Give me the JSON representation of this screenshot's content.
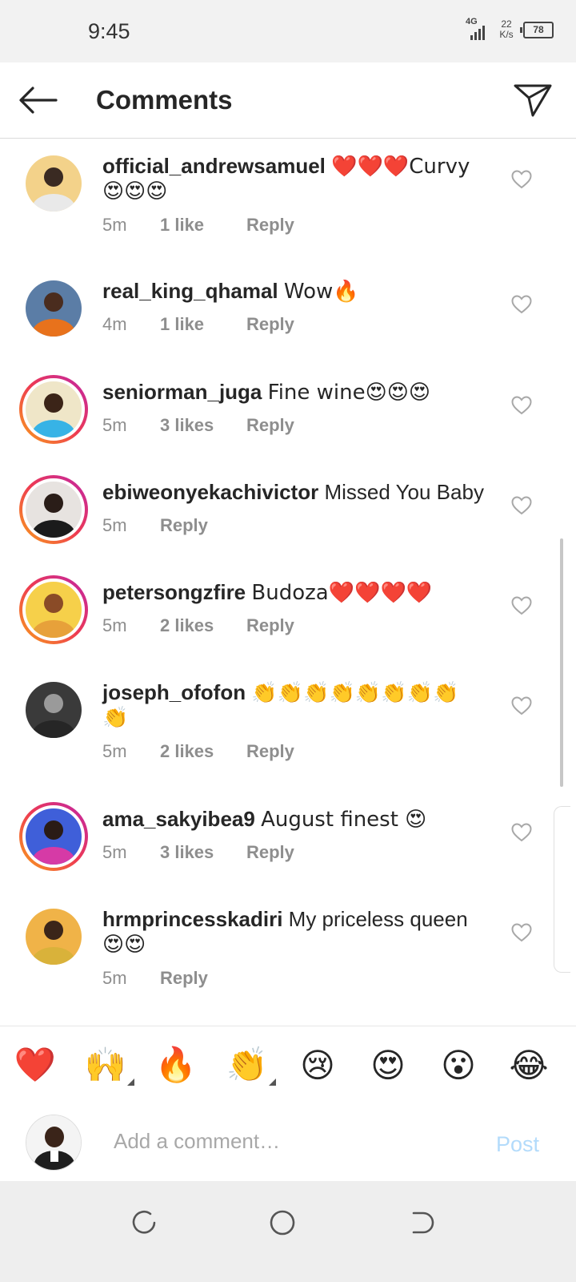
{
  "status_bar": {
    "time": "9:45",
    "network": "4G",
    "speed_value": "22",
    "speed_unit": "K/s",
    "battery": "78"
  },
  "header": {
    "title": "Comments",
    "back_icon": "arrow-left-icon",
    "share_icon": "paper-plane-icon"
  },
  "comments": [
    {
      "username": "official_andrewsamuel",
      "text_line1": "❤️❤️❤️Curvy",
      "text_line2": "😍😍😍",
      "time": "5m",
      "likes": "1 like",
      "reply": "Reply",
      "story_ring": false,
      "avatar_colors": [
        "#f3d28a",
        "#3a2a22",
        "#e9e9e9"
      ]
    },
    {
      "username": "real_king_qhamal",
      "text_line1": "Wow🔥",
      "time": "4m",
      "likes": "1 like",
      "reply": "Reply",
      "story_ring": false,
      "avatar_colors": [
        "#5b7da6",
        "#4a2c1e",
        "#e8721c"
      ]
    },
    {
      "username": "seniorman_juga",
      "text_line1": "Fine wine😍😍😍",
      "time": "5m",
      "likes": "3 likes",
      "reply": "Reply",
      "story_ring": true,
      "avatar_colors": [
        "#efe6c8",
        "#3b2418",
        "#37b3e6"
      ]
    },
    {
      "username": "ebiweonyekachivictor",
      "text_line1": "Missed You Baby",
      "time": "5m",
      "reply": "Reply",
      "story_ring": true,
      "avatar_colors": [
        "#e7e3e0",
        "#2a1d18",
        "#1b1b1b"
      ]
    },
    {
      "username": "petersongzfire",
      "text_line1": "Budoza❤️❤️❤️❤️",
      "time": "5m",
      "likes": "2 likes",
      "reply": "Reply",
      "story_ring": true,
      "avatar_colors": [
        "#f6d04a",
        "#8a4b27",
        "#e7a13a"
      ]
    },
    {
      "username": "joseph_ofofon",
      "text_line1": "👏👏👏👏👏👏👏👏",
      "text_line2": "👏",
      "time": "5m",
      "likes": "2 likes",
      "reply": "Reply",
      "story_ring": false,
      "avatar_colors": [
        "#3a3a3a",
        "#9a9a9a",
        "#262626"
      ]
    },
    {
      "username": "ama_sakyibea9",
      "text_line1": "August finest 😍",
      "time": "5m",
      "likes": "3 likes",
      "reply": "Reply",
      "story_ring": true,
      "avatar_colors": [
        "#3f5fd9",
        "#2a1b16",
        "#d63aa6"
      ]
    },
    {
      "username": "hrmprincesskadiri",
      "text_line1": "My priceless queen",
      "text_line2": "😍😍",
      "time": "5m",
      "reply": "Reply",
      "story_ring": false,
      "avatar_colors": [
        "#f0b348",
        "#3b2519",
        "#d9b23a"
      ]
    }
  ],
  "reactions": [
    "❤️",
    "🙌",
    "🔥",
    "👏",
    "😢",
    "😍",
    "😮",
    "😂"
  ],
  "composer": {
    "placeholder": "Add a comment…",
    "post_label": "Post",
    "post_color": "#b3dbfb"
  },
  "nav": {
    "recents_icon": "recents-icon",
    "home_icon": "home-circle-icon",
    "back_icon": "back-nav-icon"
  },
  "colors": {
    "text": "#262626",
    "meta": "#8e8e8e",
    "story_gradient": [
      "#f9a11a",
      "#ee3a52",
      "#c025a8"
    ]
  }
}
